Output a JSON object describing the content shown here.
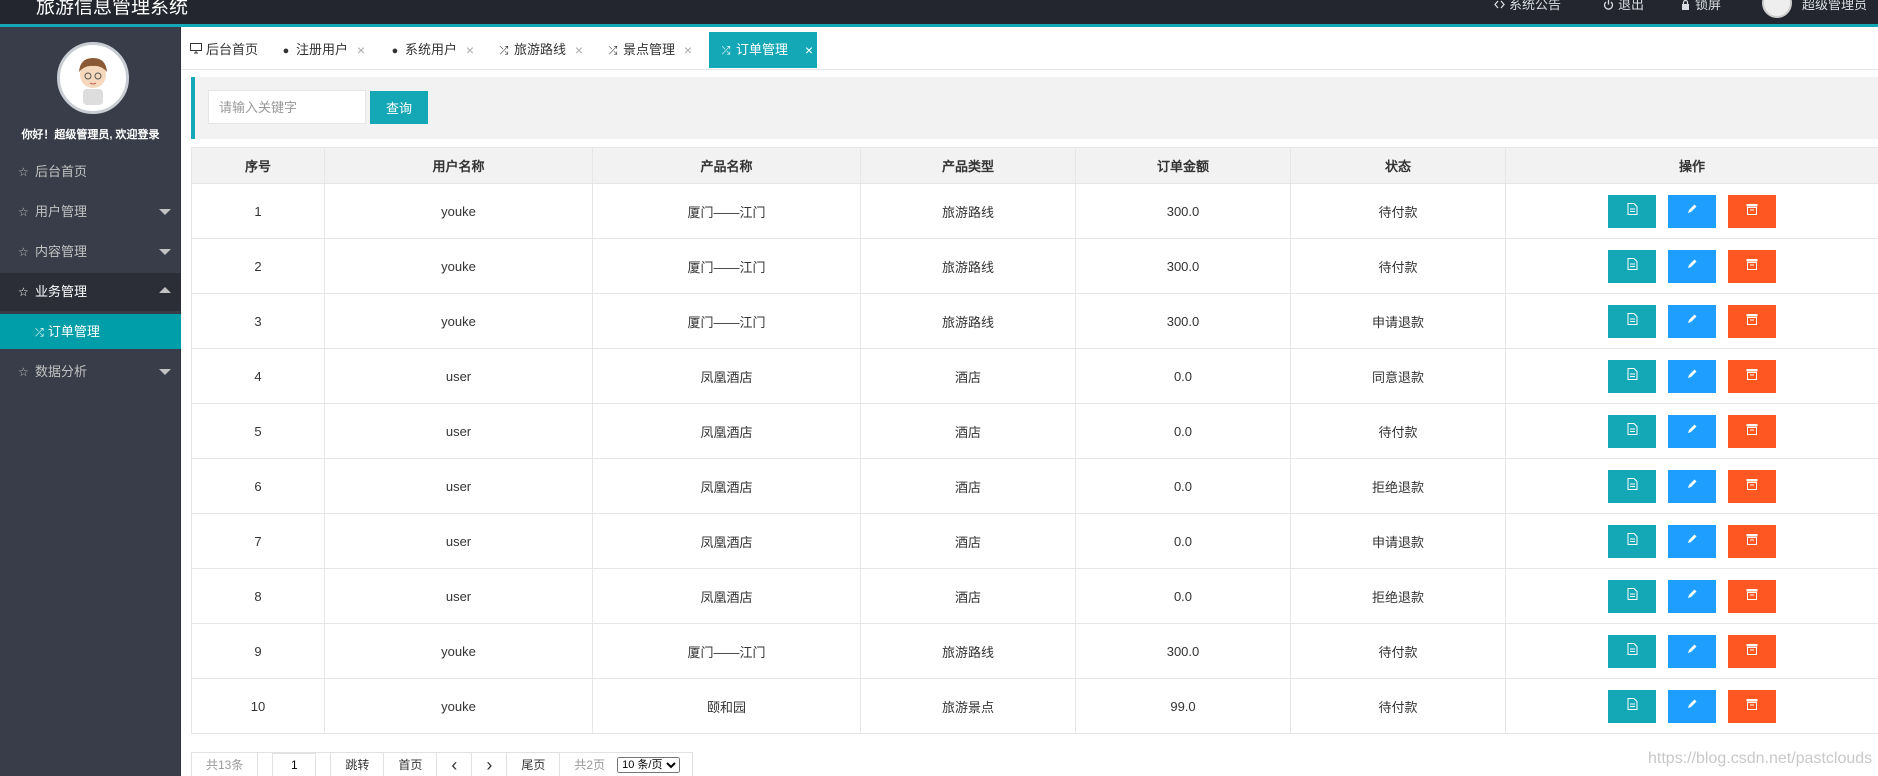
{
  "header": {
    "title": "旅游信息管理系统",
    "links": [
      "系统公告",
      "退出",
      "锁屏"
    ],
    "user": "超级管理员"
  },
  "sidebar": {
    "greeting": "你好！超级管理员, 欢迎登录",
    "items": [
      {
        "label": "后台首页"
      },
      {
        "label": "用户管理"
      },
      {
        "label": "内容管理"
      },
      {
        "label": "业务管理",
        "open": true
      },
      {
        "label": "数据分析"
      }
    ],
    "sub_item": "订单管理"
  },
  "tabs": [
    {
      "label": "后台首页",
      "icon": "monitor-icon"
    },
    {
      "label": "注册用户",
      "icon": "user-icon"
    },
    {
      "label": "系统用户",
      "icon": "user-icon"
    },
    {
      "label": "旅游路线",
      "icon": "shuffle-icon"
    },
    {
      "label": "景点管理",
      "icon": "shuffle-icon"
    },
    {
      "label": "订单管理",
      "icon": "shuffle-icon",
      "active": true
    }
  ],
  "search": {
    "placeholder": "请输入关键字",
    "button": "查询"
  },
  "table": {
    "headers": [
      "序号",
      "用户名称",
      "产品名称",
      "产品类型",
      "订单金额",
      "状态",
      "操作"
    ],
    "rows": [
      [
        "1",
        "youke",
        "厦门——江门",
        "旅游路线",
        "300.0",
        "待付款"
      ],
      [
        "2",
        "youke",
        "厦门——江门",
        "旅游路线",
        "300.0",
        "待付款"
      ],
      [
        "3",
        "youke",
        "厦门——江门",
        "旅游路线",
        "300.0",
        "申请退款"
      ],
      [
        "4",
        "user",
        "凤凰酒店",
        "酒店",
        "0.0",
        "同意退款"
      ],
      [
        "5",
        "user",
        "凤凰酒店",
        "酒店",
        "0.0",
        "待付款"
      ],
      [
        "6",
        "user",
        "凤凰酒店",
        "酒店",
        "0.0",
        "拒绝退款"
      ],
      [
        "7",
        "user",
        "凤凰酒店",
        "酒店",
        "0.0",
        "申请退款"
      ],
      [
        "8",
        "user",
        "凤凰酒店",
        "酒店",
        "0.0",
        "拒绝退款"
      ],
      [
        "9",
        "youke",
        "厦门——江门",
        "旅游路线",
        "300.0",
        "待付款"
      ],
      [
        "10",
        "youke",
        "颐和园",
        "旅游景点",
        "99.0",
        "待付款"
      ]
    ]
  },
  "pager": {
    "total": "共13条",
    "page_input": "1",
    "jump": "跳转",
    "first": "首页",
    "prev": "‹",
    "next": "›",
    "last": "尾页",
    "page_count": "共2页",
    "page_size": "10 条/页"
  },
  "watermark": "https://blog.csdn.net/pastclouds",
  "colors": {
    "accent": "#14a7b6",
    "sidebar_bg": "#393d49",
    "view_btn": "#14a7b6",
    "edit_btn": "#1e9fff",
    "delete_btn": "#ff5722"
  }
}
